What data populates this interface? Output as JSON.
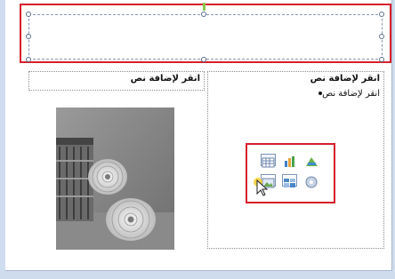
{
  "slide": {
    "left_placeholder": {
      "title": "انقر لإضافة نص"
    },
    "right_placeholder": {
      "title": "انقر لإضافة نص",
      "bullet": "انقر لإضافة نص"
    }
  },
  "content_icons": [
    "table-icon",
    "chart-icon",
    "smartart-icon",
    "picture-icon",
    "clipart-icon",
    "media-icon"
  ],
  "colors": {
    "highlight": "#d6202c",
    "background": "#cfdcee"
  }
}
